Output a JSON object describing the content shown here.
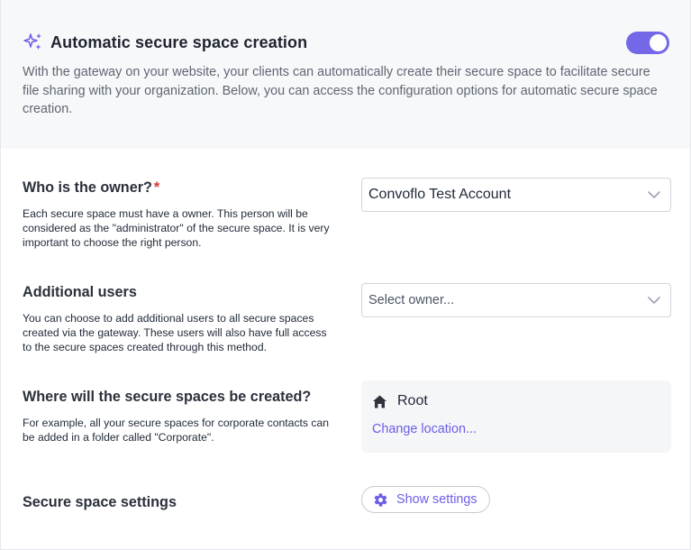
{
  "header": {
    "title": "Automatic secure space creation",
    "icon": "sparkles-icon",
    "toggle_on": true,
    "description": "With the gateway on your website, your clients can automatically create their secure space to facilitate secure file sharing with your organization. Below, you can access the configuration options for automatic secure space creation."
  },
  "owner": {
    "title": "Who is the owner?",
    "required_mark": "*",
    "description": "Each secure space must have a owner. This person will be considered as the \"administrator\" of the secure space. It is very important to choose the right person.",
    "selected_value": "Convoflo Test Account"
  },
  "additional_users": {
    "title": "Additional users",
    "description": "You can choose to add additional users to all secure spaces created via the gateway. These users will also have full access to the secure spaces created through this method.",
    "placeholder": "Select owner..."
  },
  "location": {
    "title": "Where will the secure spaces be created?",
    "description": "For example, all your secure spaces for corporate contacts can be added in a folder called \"Corporate\".",
    "current_folder": "Root",
    "change_link": "Change location..."
  },
  "settings": {
    "title": "Secure space settings",
    "button_label": "Show settings"
  },
  "colors": {
    "accent": "#7468e8",
    "link": "#6b5fe6",
    "required": "#d93838",
    "header_bg": "#f7f8fa"
  }
}
